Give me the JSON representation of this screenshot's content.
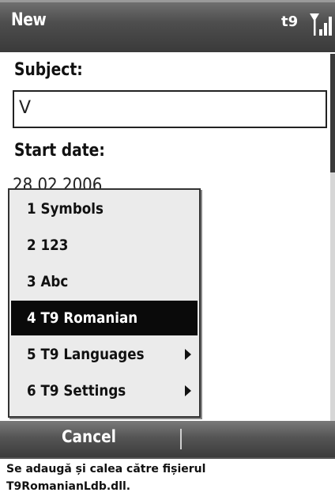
{
  "header": {
    "title": "New",
    "input_mode": "t9"
  },
  "form": {
    "subject_label": "Subject:",
    "subject_value": "V",
    "start_date_label": "Start date:",
    "start_date_value": "28.02.2006"
  },
  "menu": {
    "items": [
      {
        "label": "1 Symbols",
        "submenu": false,
        "selected": false
      },
      {
        "label": "2 123",
        "submenu": false,
        "selected": false
      },
      {
        "label": "3 Abc",
        "submenu": false,
        "selected": false
      },
      {
        "label": "4 T9 Romanian",
        "submenu": false,
        "selected": true
      },
      {
        "label": "5 T9 Languages",
        "submenu": true,
        "selected": false
      },
      {
        "label": "6 T9 Settings",
        "submenu": true,
        "selected": false
      }
    ]
  },
  "softkeys": {
    "left": "Cancel"
  },
  "caption": {
    "line1": "Se adaugă și calea către fișierul",
    "line2": "T9RomanianLdb.dll."
  },
  "colors": {
    "title_bar": "#4e4e4e",
    "selection": "#0a0a0a",
    "menu_bg": "#ebebeb"
  }
}
